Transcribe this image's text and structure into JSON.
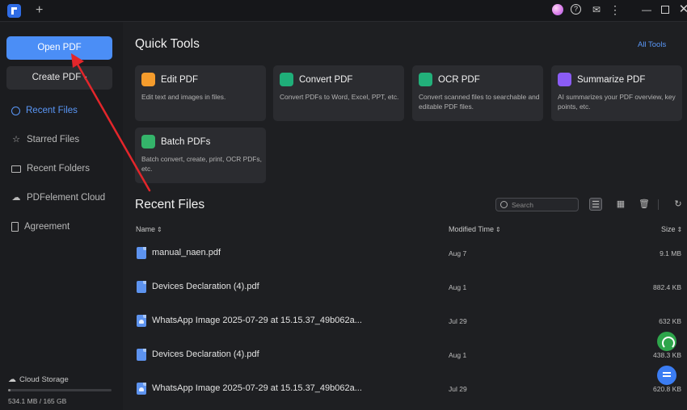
{
  "titlebar": {
    "new_tab": "+",
    "help": "?",
    "chat": "✉",
    "more": "⋮",
    "minimize": "—",
    "close": "✕"
  },
  "sidebar": {
    "open_pdf": "Open PDF",
    "create_pdf": "Create PDF",
    "create_pdf_chevron": "▾",
    "items": [
      {
        "label": "Recent Files",
        "icon": "clock-icon",
        "glyph": "",
        "active": true
      },
      {
        "label": "Starred Files",
        "icon": "star-icon",
        "glyph": "☆",
        "active": false
      },
      {
        "label": "Recent Folders",
        "icon": "folder-icon",
        "glyph": "",
        "active": false
      },
      {
        "label": "PDFelement Cloud",
        "icon": "cloud-icon",
        "glyph": "☁",
        "active": false
      },
      {
        "label": "Agreement",
        "icon": "document-icon",
        "glyph": "",
        "active": false
      }
    ],
    "cloud_storage": "Cloud Storage",
    "cloud_glyph": "☁",
    "storage_used": "534.1 MB / 165 GB",
    "storage_fraction": 0.003
  },
  "quick_tools": {
    "title": "Quick Tools",
    "all_tools": "All Tools",
    "cards": [
      {
        "title": "Edit PDF",
        "desc": "Edit text and images in files.",
        "color": "#f59c2c"
      },
      {
        "title": "Convert PDF",
        "desc": "Convert PDFs to Word, Excel, PPT, etc.",
        "color": "#1fae79"
      },
      {
        "title": "OCR PDF",
        "desc": "Convert scanned files to searchable and editable PDF files.",
        "color": "#22b07a"
      },
      {
        "title": "Summarize PDF",
        "desc": "AI summarizes your PDF overview, key points, etc.",
        "color": "#8b5cf6"
      },
      {
        "title": "Batch PDFs",
        "desc": "Batch convert, create, print, OCR PDFs, etc.",
        "color": "#34b46a"
      }
    ]
  },
  "recent": {
    "title": "Recent Files",
    "search_placeholder": "Search",
    "columns": {
      "name": "Name",
      "modified": "Modified Time",
      "size": "Size",
      "sort_glyph": "⇕"
    },
    "files": [
      {
        "name": "manual_naen.pdf",
        "modified": "Aug 7",
        "size": "9.1 MB",
        "type": "pdf"
      },
      {
        "name": "Devices Declaration (4).pdf",
        "modified": "Aug 1",
        "size": "882.4 KB",
        "type": "pdf"
      },
      {
        "name": "WhatsApp Image 2025-07-29 at 15.15.37_49b062a...",
        "modified": "Jul 29",
        "size": "632 KB",
        "type": "image"
      },
      {
        "name": "Devices Declaration (4).pdf",
        "modified": "Aug 1",
        "size": "438.3 KB",
        "type": "pdf"
      },
      {
        "name": "WhatsApp Image 2025-07-29 at 15.15.37_49b062a...",
        "modified": "Jul 29",
        "size": "620.8 KB",
        "type": "image"
      }
    ]
  },
  "colors": {
    "accent": "#4b8ef6",
    "active_nav": "#5a97f7",
    "annotation_arrow": "#e3262b",
    "support_fab": "#2ea54b",
    "chat_fab": "#3b7df3"
  }
}
